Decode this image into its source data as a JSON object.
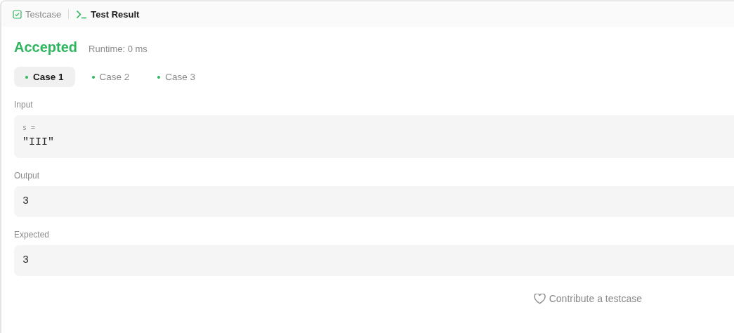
{
  "panel_tabs": [
    {
      "label": "Testcase",
      "kind": "testcase",
      "selected": false
    },
    {
      "label": "Test Result",
      "kind": "result",
      "selected": true
    }
  ],
  "result": {
    "status": "Accepted",
    "accepted": true,
    "runtime": "Runtime: 0 ms"
  },
  "cases": [
    {
      "label": "Case 1",
      "selected": true,
      "passed": true
    },
    {
      "label": "Case 2",
      "selected": false,
      "passed": true
    },
    {
      "label": "Case 3",
      "selected": false,
      "passed": true
    }
  ],
  "input": {
    "label": "Input",
    "variable": "s =",
    "value": "\"III\""
  },
  "output": {
    "label": "Output",
    "value": "3"
  },
  "expected": {
    "label": "Expected",
    "value": "3"
  },
  "contribute_link": "Contribute a testcase"
}
